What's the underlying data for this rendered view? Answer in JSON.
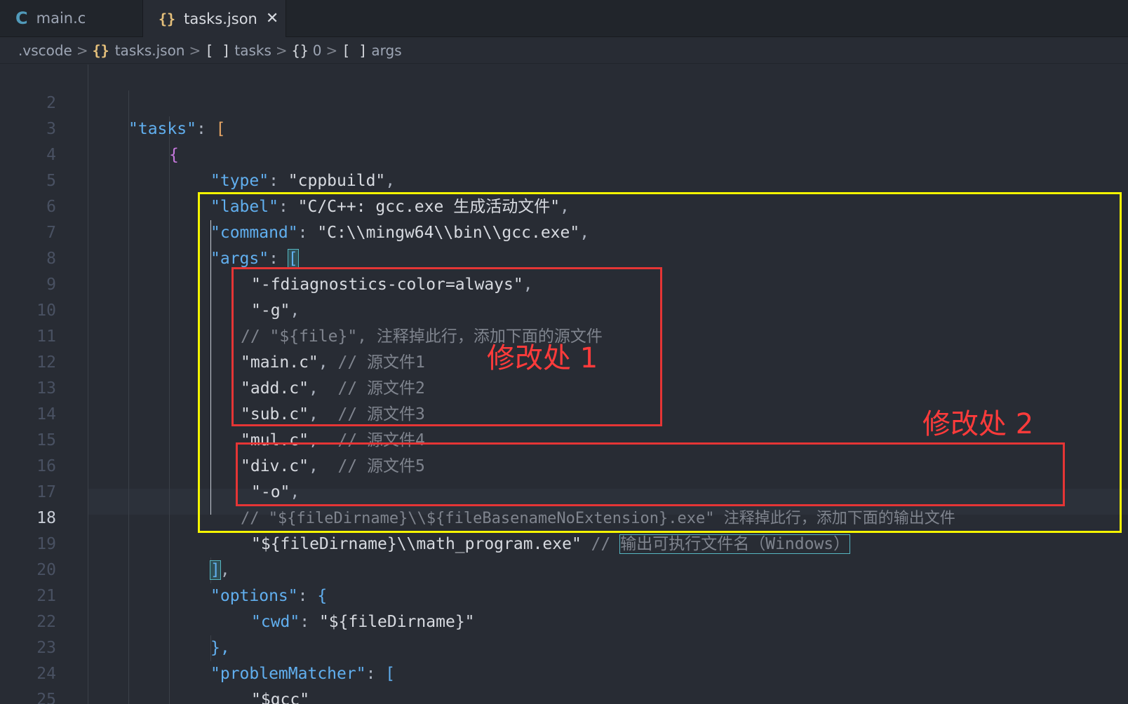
{
  "tabs": [
    {
      "label": "main.c",
      "icon": "c-file-icon"
    },
    {
      "label": "tasks.json",
      "icon": "json-file-icon",
      "close": "✕"
    }
  ],
  "breadcrumb": [
    {
      "text": ".vscode",
      "icon": ""
    },
    {
      "text": "tasks.json",
      "icon": "{}"
    },
    {
      "text": "tasks",
      "icon": "[ ]"
    },
    {
      "text": "0",
      "icon": "{}"
    },
    {
      "text": "args",
      "icon": "[ ]"
    }
  ],
  "breadcrumb_sep": ">",
  "icons": {
    "c": "C",
    "json": "{}"
  },
  "colors": {
    "background": "#282c34",
    "highlight_yellow": "#f5f500",
    "highlight_red": "#e53535",
    "annotation_text": "#ff3b3b"
  },
  "lines": [
    {
      "n": "2"
    },
    {
      "n": "3"
    },
    {
      "n": "4"
    },
    {
      "n": "5"
    },
    {
      "n": "6"
    },
    {
      "n": "7"
    },
    {
      "n": "8"
    },
    {
      "n": "9"
    },
    {
      "n": "10"
    },
    {
      "n": "11"
    },
    {
      "n": "12"
    },
    {
      "n": "13"
    },
    {
      "n": "14"
    },
    {
      "n": "15"
    },
    {
      "n": "16"
    },
    {
      "n": "17"
    },
    {
      "n": "18"
    },
    {
      "n": "19"
    },
    {
      "n": "20"
    },
    {
      "n": "21"
    },
    {
      "n": "22"
    },
    {
      "n": "23"
    },
    {
      "n": "24"
    },
    {
      "n": "25"
    }
  ],
  "code": {
    "l2_key": "\"tasks\"",
    "l2_colon": ": ",
    "l2_br": "[",
    "l3": "{",
    "l4_key": "\"type\"",
    "l4_val": "\"cppbuild\"",
    "l5_key": "\"label\"",
    "l5_val": "\"C/C++: gcc.exe 生成活动文件\"",
    "l6_key": "\"command\"",
    "l6_val": "\"C:\\\\mingw64\\\\bin\\\\gcc.exe\"",
    "l7_key": "\"args\"",
    "l7_br": "[",
    "l8_val": "\"-fdiagnostics-color=always\"",
    "l9_val": "\"-g\"",
    "l10_comment": "// \"${file}\", 注释掉此行，添加下面的源文件",
    "l11_val": "\"main.c\"",
    "l11_comment": "// 源文件1",
    "l12_val": "\"add.c\"",
    "l12_comment": "// 源文件2",
    "l13_val": "\"sub.c\"",
    "l13_comment": "// 源文件3",
    "l14_val": "\"mul.c\"",
    "l14_comment": "// 源文件4",
    "l15_val": "\"div.c\"",
    "l15_comment": "// 源文件5",
    "l16_val": "\"-o\"",
    "l17_comment": "// \"${fileDirname}\\\\${fileBasenameNoExtension}.exe\" 注释掉此行，添加下面的输出文件",
    "l18_val": "\"${fileDirname}\\\\math_program.exe\"",
    "l18_comment_prefix": "// ",
    "l18_comment": "输出可执行文件名（Windows）",
    "l19_br": "]",
    "l19_tail": ",",
    "l20_key": "\"options\"",
    "l20_br": "{",
    "l21_key": "\"cwd\"",
    "l21_val": "\"${fileDirname}\"",
    "l22": "},",
    "l23_key": "\"problemMatcher\"",
    "l23_br": "[",
    "l24_val": "\"$gcc\"",
    "l25": "],"
  },
  "annotations": {
    "mod1": "修改处 1",
    "mod2": "修改处 2"
  }
}
